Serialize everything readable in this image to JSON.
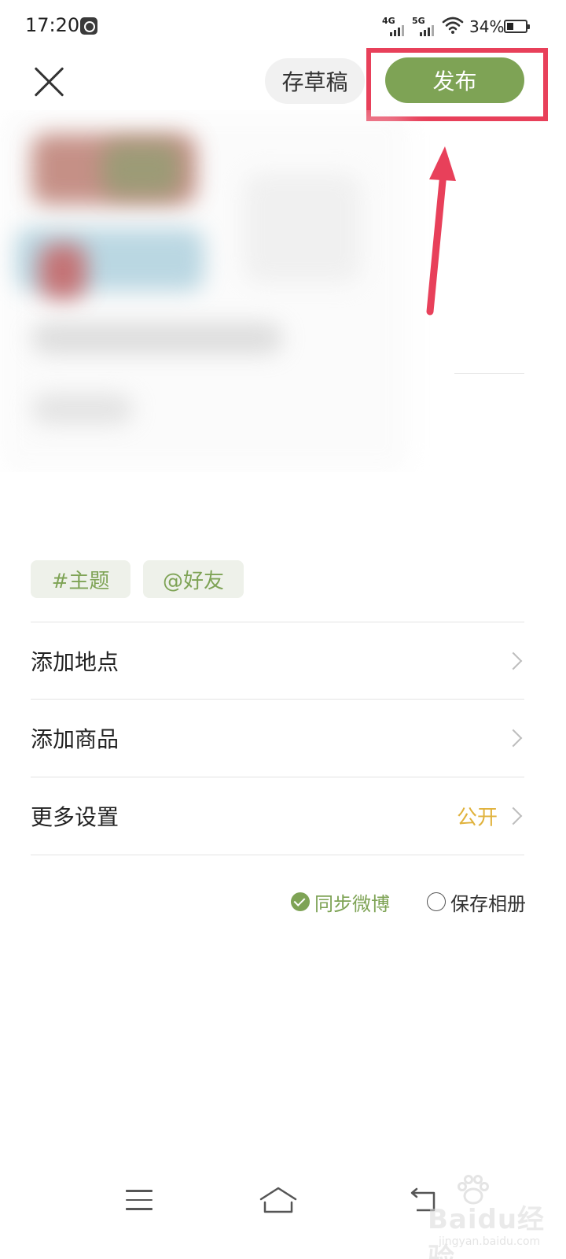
{
  "status_bar": {
    "time": "17:20",
    "network_1": "4G",
    "network_2": "5G",
    "battery_percent": "34%"
  },
  "top_bar": {
    "draft_label": "存草稿",
    "publish_label": "发布"
  },
  "tags": {
    "topic_label": "#主题",
    "friend_label": "@好友"
  },
  "settings": {
    "rows": [
      {
        "label": "添加地点",
        "value": ""
      },
      {
        "label": "添加商品",
        "value": ""
      },
      {
        "label": "更多设置",
        "value": "公开"
      }
    ]
  },
  "options": {
    "sync_label": "同步微博",
    "sync_checked": true,
    "album_label": "保存相册",
    "album_checked": false
  },
  "watermark": {
    "text": "Baidu经验",
    "url": "jingyan.baidu.com"
  },
  "colors": {
    "accent_green": "#7ea355",
    "highlight_red": "#e8405a",
    "value_yellow": "#e0b23c"
  }
}
